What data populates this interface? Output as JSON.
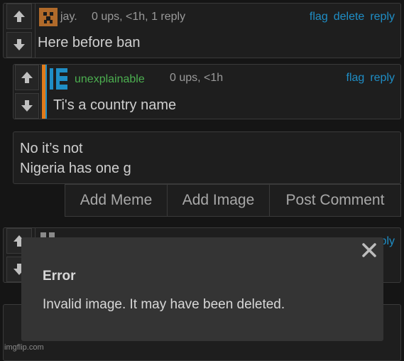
{
  "comments": [
    {
      "username": "jay.",
      "meta": "0 ups, <1h, 1 reply",
      "actions": [
        "flag",
        "delete",
        "reply"
      ],
      "text": "Here before ban"
    },
    {
      "username": "unexplainable",
      "meta": "0 ups, <1h",
      "actions": [
        "flag",
        "reply"
      ],
      "text": "Ti's a country name"
    }
  ],
  "reply_box": {
    "value_line1": "No it’s not",
    "value_line2": "Nigeria has one g"
  },
  "buttons": {
    "add_meme": "Add Meme",
    "add_image": "Add Image",
    "post_comment": "Post Comment"
  },
  "partial_comment": {
    "action_partial": "ply"
  },
  "modal": {
    "title": "Error",
    "message": "Invalid image. It may have been deleted."
  },
  "watermark": "imgflip.com",
  "colors": {
    "link": "#1f8ec6",
    "username_green": "#4caf50",
    "username_gray": "#9a9a9a",
    "reply_indent_bar": "#1f8ec6",
    "reply_indent_bar2": "#e07b1a"
  },
  "icons": [
    "upvote-arrow-icon",
    "downvote-arrow-icon",
    "close-icon",
    "avatar-icon"
  ]
}
